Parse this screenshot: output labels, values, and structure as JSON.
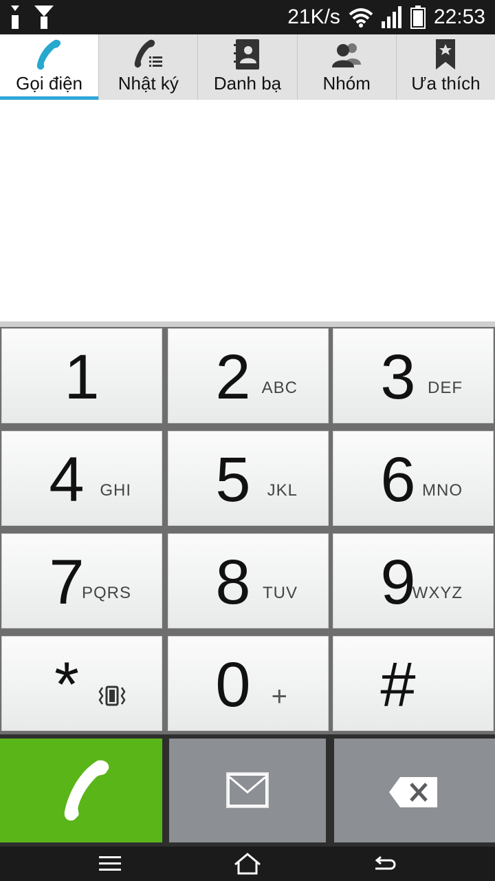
{
  "status_bar": {
    "net_speed": "21K/s",
    "time": "22:53",
    "icons": [
      "usb-icon",
      "download-icon",
      "wifi-icon",
      "signal-icon",
      "battery-icon"
    ]
  },
  "tabs": [
    {
      "label": "Gọi điện",
      "icon": "phone-icon",
      "active": true
    },
    {
      "label": "Nhật ký",
      "icon": "call-log-icon"
    },
    {
      "label": "Danh bạ",
      "icon": "contacts-book-icon"
    },
    {
      "label": "Nhóm",
      "icon": "group-icon"
    },
    {
      "label": "Ưa thích",
      "icon": "favorite-bookmark-icon"
    }
  ],
  "keypad": [
    {
      "digit": "1",
      "letters": ""
    },
    {
      "digit": "2",
      "letters": "ABC"
    },
    {
      "digit": "3",
      "letters": "DEF"
    },
    {
      "digit": "4",
      "letters": "GHI"
    },
    {
      "digit": "5",
      "letters": "JKL"
    },
    {
      "digit": "6",
      "letters": "MNO"
    },
    {
      "digit": "7",
      "letters": "PQRS"
    },
    {
      "digit": "8",
      "letters": "TUV"
    },
    {
      "digit": "9",
      "letters": "WXYZ"
    },
    {
      "digit": "*",
      "letters": ""
    },
    {
      "digit": "0",
      "letters": "+"
    },
    {
      "digit": "#",
      "letters": ""
    }
  ],
  "colors": {
    "active_tab_underline": "#2fa7d8",
    "call_button": "#5ab519",
    "secondary_button": "#8c8f93"
  }
}
